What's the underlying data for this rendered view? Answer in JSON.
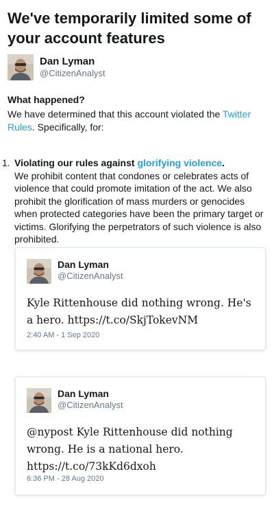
{
  "title": "We've temporarily limited some of your account features",
  "profile": {
    "name": "Dan Lyman",
    "handle": "@CitizenAnalyst"
  },
  "what_happened": {
    "heading": "What happened?",
    "text_before": "We have determined that this account violated the ",
    "link": "Twitter Rules",
    "text_after": ". Specifically, for:"
  },
  "violations": [
    {
      "number": "1.",
      "title_before": "Violating our rules against ",
      "title_link": "glorifying violence",
      "title_after": ".",
      "description": "We prohibit content that condones or celebrates acts of violence that could promote imitation of the act. We also prohibit the glorification of mass murders or genocides when protected categories have been the primary target or victims. Glorifying the perpetrators of such violence is also prohibited."
    }
  ],
  "tweets": [
    {
      "name": "Dan Lyman",
      "handle": "@CitizenAnalyst",
      "text": "Kyle Rittenhouse did nothing wrong. He's a hero. https://t.co/SkjTokevNM",
      "timestamp": "2:40 AM - 1 Sep 2020"
    },
    {
      "name": "Dan Lyman",
      "handle": "@CitizenAnalyst",
      "text": "@nypost Kyle Rittenhouse did nothing wrong. He is a national hero. https://t.co/73kKd6dxoh",
      "timestamp": "6:36 PM - 28 Aug 2020"
    }
  ],
  "colors": {
    "link": "#1da1f2",
    "secondary_text": "#657786",
    "primary_text": "#14171a",
    "card_border": "#e1e8ed"
  }
}
